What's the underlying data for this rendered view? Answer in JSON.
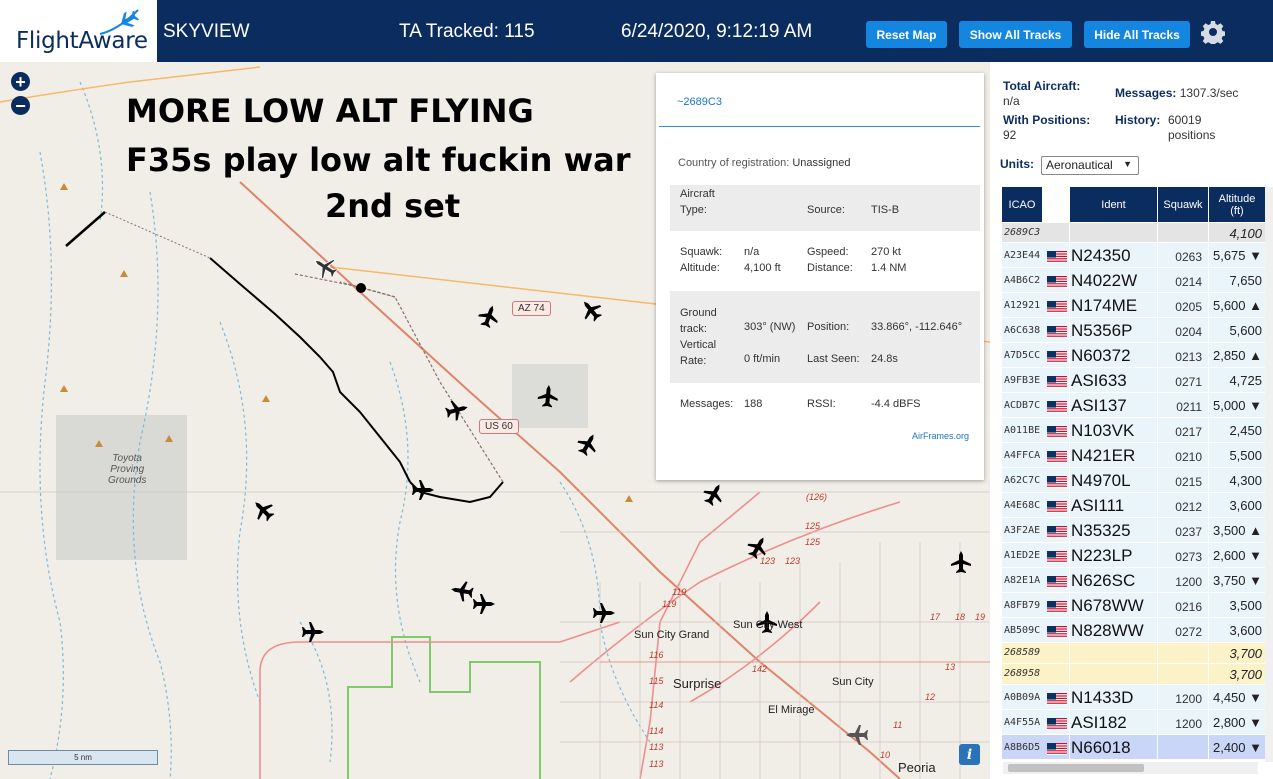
{
  "header": {
    "logo_text": "FlightAware",
    "title": "SKYVIEW",
    "tracked": "TA Tracked: 115",
    "datetime": "6/24/2020, 9:12:19 AM",
    "buttons": {
      "reset": "Reset Map",
      "show": "Show All Tracks",
      "hide": "Hide All Tracks"
    },
    "settings_icon": "gear-icon",
    "colors": {
      "bar": "#0b2c5f",
      "button": "#1586e0"
    }
  },
  "map": {
    "zoom_in": "+",
    "zoom_out": "−",
    "overlay_lines": [
      "MORE LOW ALT FLYING",
      "F35s play low alt fuckin war",
      "2nd set"
    ],
    "labels": {
      "toyota": "Toyota\nProving\nGrounds",
      "sun_city_grand": "Sun City Grand",
      "sun_city_west": "Sun City West",
      "surprise": "Surprise",
      "sun_city": "Sun City",
      "el_mirage": "El Mirage",
      "peoria": "Peoria"
    },
    "shields": {
      "az74": "AZ 74",
      "us60": "US 60"
    },
    "road_numbers": [
      "(126)",
      "125",
      "125",
      "123",
      "123",
      "119",
      "119",
      "116",
      "115",
      "114",
      "114",
      "113",
      "142",
      "17",
      "18",
      "19",
      "13",
      "12",
      "11",
      "10",
      "113"
    ],
    "scale": "5 nm",
    "info": "i"
  },
  "popup": {
    "title": "~2689C3",
    "country_label": "Country of registration:",
    "country_value": "Unassigned",
    "aircraft_type_label": "Aircraft\nType:",
    "source_label": "Source:",
    "source_value": "TIS-B",
    "squawk_label": "Squawk:",
    "squawk_value": "n/a",
    "altitude_label": "Altitude:",
    "altitude_value": "4,100 ft",
    "gspeed_label": "Gspeed:",
    "gspeed_value": "270 kt",
    "distance_label": "Distance:",
    "distance_value": "1.4 NM",
    "ground_track_label": "Ground\ntrack:",
    "ground_track_value": "303° (NW)",
    "position_label": "Position:",
    "position_value": "33.866°, -112.646°",
    "vertical_rate_label": "Vertical\nRate:",
    "vertical_rate_value": "0 ft/min",
    "last_seen_label": "Last Seen:",
    "last_seen_value": "24.8s",
    "messages_label": "Messages:",
    "messages_value": "188",
    "rssi_label": "RSSI:",
    "rssi_value": "-4.4 dBFS",
    "airframes": "AirFrames.org"
  },
  "stats": {
    "total_label": "Total Aircraft:",
    "total_value": "n/a",
    "messages_label": "Messages:",
    "messages_value": "1307.3/sec",
    "positions_label": "With Positions:",
    "positions_value": "92",
    "history_label": "History:",
    "history_value": "60019\npositions",
    "units_label": "Units:",
    "units_value": "Aeronautical"
  },
  "table": {
    "headers": [
      "ICAO",
      "Ident",
      "Squawk",
      "Altitude\n(ft)"
    ],
    "rows": [
      {
        "icao": "2689C3",
        "flag": false,
        "ident": "",
        "squawk": "",
        "alt": "4,100",
        "style": "gray"
      },
      {
        "icao": "A23E44",
        "flag": true,
        "ident": "N24350",
        "squawk": "0263",
        "alt": "5,675 ▼",
        "style": "norm"
      },
      {
        "icao": "A4B6C2",
        "flag": true,
        "ident": "N4022W",
        "squawk": "0214",
        "alt": "7,650",
        "style": "norm"
      },
      {
        "icao": "A12921",
        "flag": true,
        "ident": "N174ME",
        "squawk": "0205",
        "alt": "5,600 ▲",
        "style": "norm"
      },
      {
        "icao": "A6C638",
        "flag": true,
        "ident": "N5356P",
        "squawk": "0204",
        "alt": "5,600",
        "style": "norm"
      },
      {
        "icao": "A7D5CC",
        "flag": true,
        "ident": "N60372",
        "squawk": "0213",
        "alt": "2,850 ▲",
        "style": "norm"
      },
      {
        "icao": "A9FB3E",
        "flag": true,
        "ident": "ASI633",
        "squawk": "0271",
        "alt": "4,725",
        "style": "norm"
      },
      {
        "icao": "ACDB7C",
        "flag": true,
        "ident": "ASI137",
        "squawk": "0211",
        "alt": "5,000 ▼",
        "style": "norm"
      },
      {
        "icao": "A011BE",
        "flag": true,
        "ident": "N103VK",
        "squawk": "0217",
        "alt": "2,450",
        "style": "norm"
      },
      {
        "icao": "A4FFCA",
        "flag": true,
        "ident": "N421ER",
        "squawk": "0210",
        "alt": "5,500",
        "style": "norm"
      },
      {
        "icao": "A62C7C",
        "flag": true,
        "ident": "N4970L",
        "squawk": "0215",
        "alt": "4,300",
        "style": "norm"
      },
      {
        "icao": "A4E68C",
        "flag": true,
        "ident": "ASI111",
        "squawk": "0212",
        "alt": "3,600",
        "style": "norm"
      },
      {
        "icao": "A3F2AE",
        "flag": true,
        "ident": "N35325",
        "squawk": "0237",
        "alt": "3,500 ▲",
        "style": "norm"
      },
      {
        "icao": "A1ED2E",
        "flag": true,
        "ident": "N223LP",
        "squawk": "0273",
        "alt": "2,600 ▼",
        "style": "norm"
      },
      {
        "icao": "A82E1A",
        "flag": true,
        "ident": "N626SC",
        "squawk": "1200",
        "alt": "3,750 ▼",
        "style": "norm"
      },
      {
        "icao": "A8FB79",
        "flag": true,
        "ident": "N678WW",
        "squawk": "0216",
        "alt": "3,500",
        "style": "norm"
      },
      {
        "icao": "AB509C",
        "flag": true,
        "ident": "N828WW",
        "squawk": "0272",
        "alt": "3,600",
        "style": "norm"
      },
      {
        "icao": "268589",
        "flag": false,
        "ident": "",
        "squawk": "",
        "alt": "3,700",
        "style": "yellow"
      },
      {
        "icao": "268958",
        "flag": false,
        "ident": "",
        "squawk": "",
        "alt": "3,700",
        "style": "yellow"
      },
      {
        "icao": "A0B09A",
        "flag": true,
        "ident": "N1433D",
        "squawk": "1200",
        "alt": "4,450 ▼",
        "style": "norm"
      },
      {
        "icao": "A4F55A",
        "flag": true,
        "ident": "ASI182",
        "squawk": "1200",
        "alt": "2,800 ▼",
        "style": "norm"
      },
      {
        "icao": "A8B6D5",
        "flag": true,
        "ident": "N66018",
        "squawk": "",
        "alt": "2,400 ▼",
        "style": "sel"
      }
    ]
  }
}
